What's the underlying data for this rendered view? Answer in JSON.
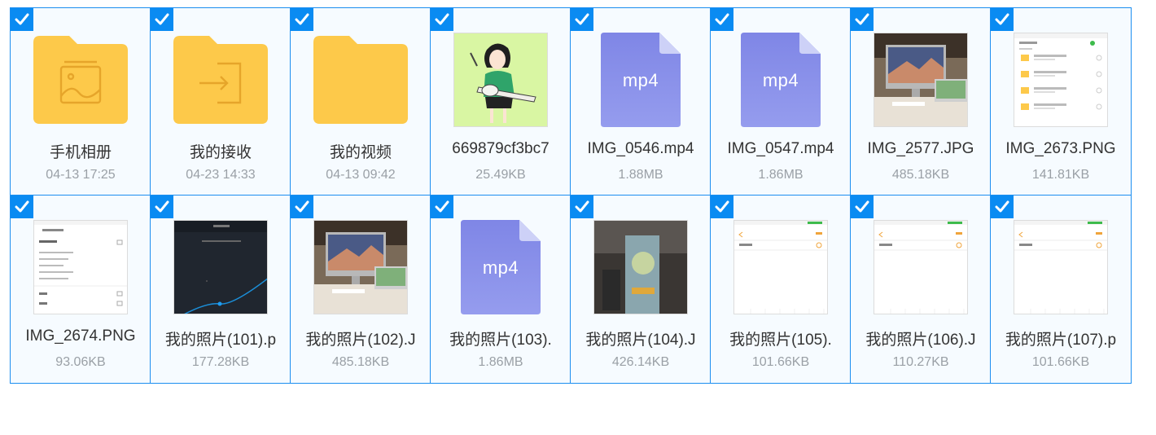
{
  "colors": {
    "accent": "#0a8bf2",
    "folder": "#fdc94a",
    "folder_glyph": "#e6a52a",
    "mp4_fill": "#8c93e8",
    "mp4_fold": "#cdd1f7"
  },
  "files": [
    {
      "name": "手机相册",
      "meta": "04-13 17:25",
      "kind": "folder",
      "icon": "photo-album-folder-icon",
      "selected": true
    },
    {
      "name": "我的接收",
      "meta": "04-23 14:33",
      "kind": "folder",
      "icon": "received-folder-icon",
      "selected": true
    },
    {
      "name": "我的视频",
      "meta": "04-13 09:42",
      "kind": "folder",
      "icon": "folder-icon",
      "selected": true
    },
    {
      "name": "669879cf3bc7",
      "meta": "25.49KB",
      "kind": "image",
      "icon": "illustration-thumbnail",
      "selected": true
    },
    {
      "name": "IMG_0546.mp4",
      "meta": "1.88MB",
      "kind": "video",
      "icon": "mp4-file-icon",
      "ext": "mp4",
      "selected": true
    },
    {
      "name": "IMG_0547.mp4",
      "meta": "1.86MB",
      "kind": "video",
      "icon": "mp4-file-icon",
      "ext": "mp4",
      "selected": true
    },
    {
      "name": "IMG_2577.JPG",
      "meta": "485.18KB",
      "kind": "image",
      "icon": "desk-photo-thumbnail",
      "selected": true
    },
    {
      "name": "IMG_2673.PNG",
      "meta": "141.81KB",
      "kind": "image",
      "icon": "screenshot-thumbnail",
      "selected": true
    },
    {
      "name": "IMG_2674.PNG",
      "meta": "93.06KB",
      "kind": "image",
      "icon": "screenshot-thumbnail",
      "selected": true
    },
    {
      "name": "我的照片(101).p",
      "meta": "177.28KB",
      "kind": "image",
      "icon": "dark-screenshot-thumbnail",
      "selected": true
    },
    {
      "name": "我的照片(102).J",
      "meta": "485.18KB",
      "kind": "image",
      "icon": "desk-photo-thumbnail",
      "selected": true
    },
    {
      "name": "我的照片(103).",
      "meta": "1.86MB",
      "kind": "video",
      "icon": "mp4-file-icon",
      "ext": "mp4",
      "selected": true
    },
    {
      "name": "我的照片(104).J",
      "meta": "426.14KB",
      "kind": "image",
      "icon": "totoro-photo-thumbnail",
      "selected": true
    },
    {
      "name": "我的照片(105).",
      "meta": "101.66KB",
      "kind": "image",
      "icon": "form-screenshot-thumbnail",
      "selected": true
    },
    {
      "name": "我的照片(106).J",
      "meta": "110.27KB",
      "kind": "image",
      "icon": "form-screenshot-thumbnail",
      "selected": true
    },
    {
      "name": "我的照片(107).p",
      "meta": "101.66KB",
      "kind": "image",
      "icon": "form-screenshot-thumbnail",
      "selected": true
    }
  ]
}
